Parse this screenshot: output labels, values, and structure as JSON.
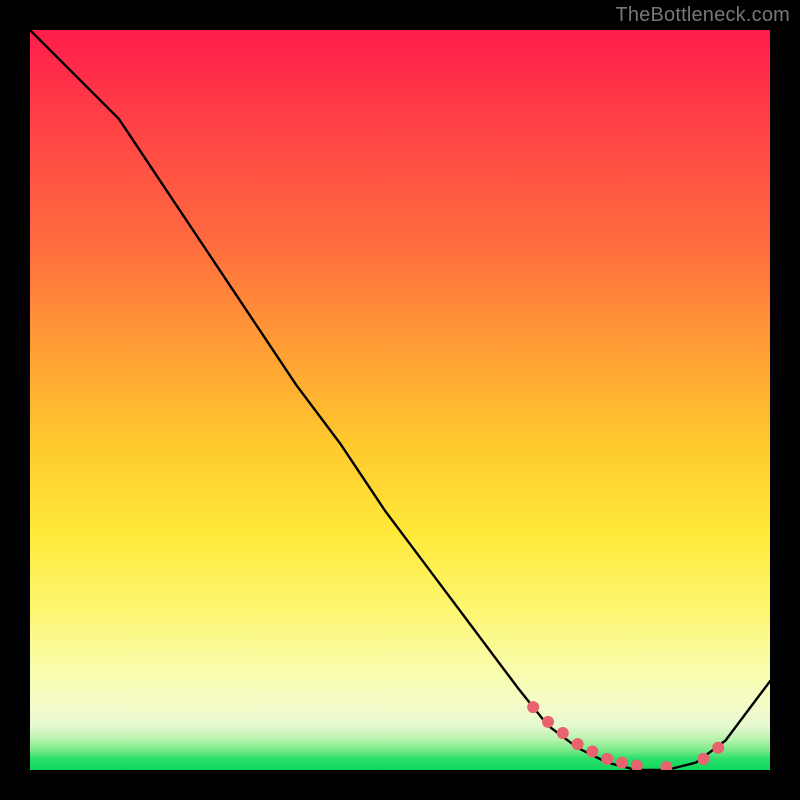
{
  "watermark": "TheBottleneck.com",
  "chart_data": {
    "type": "line",
    "title": "",
    "xlabel": "",
    "ylabel": "",
    "xlim": [
      0,
      100
    ],
    "ylim": [
      0,
      100
    ],
    "series": [
      {
        "name": "bottleneck-curve",
        "x": [
          0,
          6,
          12,
          18,
          24,
          30,
          36,
          42,
          48,
          54,
          60,
          66,
          70,
          74,
          78,
          82,
          86,
          90,
          94,
          100
        ],
        "y": [
          100,
          94,
          88,
          79,
          70,
          61,
          52,
          44,
          35,
          27,
          19,
          11,
          6,
          3,
          1,
          0,
          0,
          1,
          4,
          12
        ]
      }
    ],
    "markers": {
      "name": "highlight-dots",
      "color": "#e9636f",
      "x": [
        68,
        70,
        72,
        74,
        76,
        78,
        80,
        82,
        86,
        91,
        93
      ],
      "y": [
        8.5,
        6.5,
        5.0,
        3.5,
        2.5,
        1.5,
        1.0,
        0.6,
        0.4,
        1.5,
        3.0
      ]
    }
  }
}
